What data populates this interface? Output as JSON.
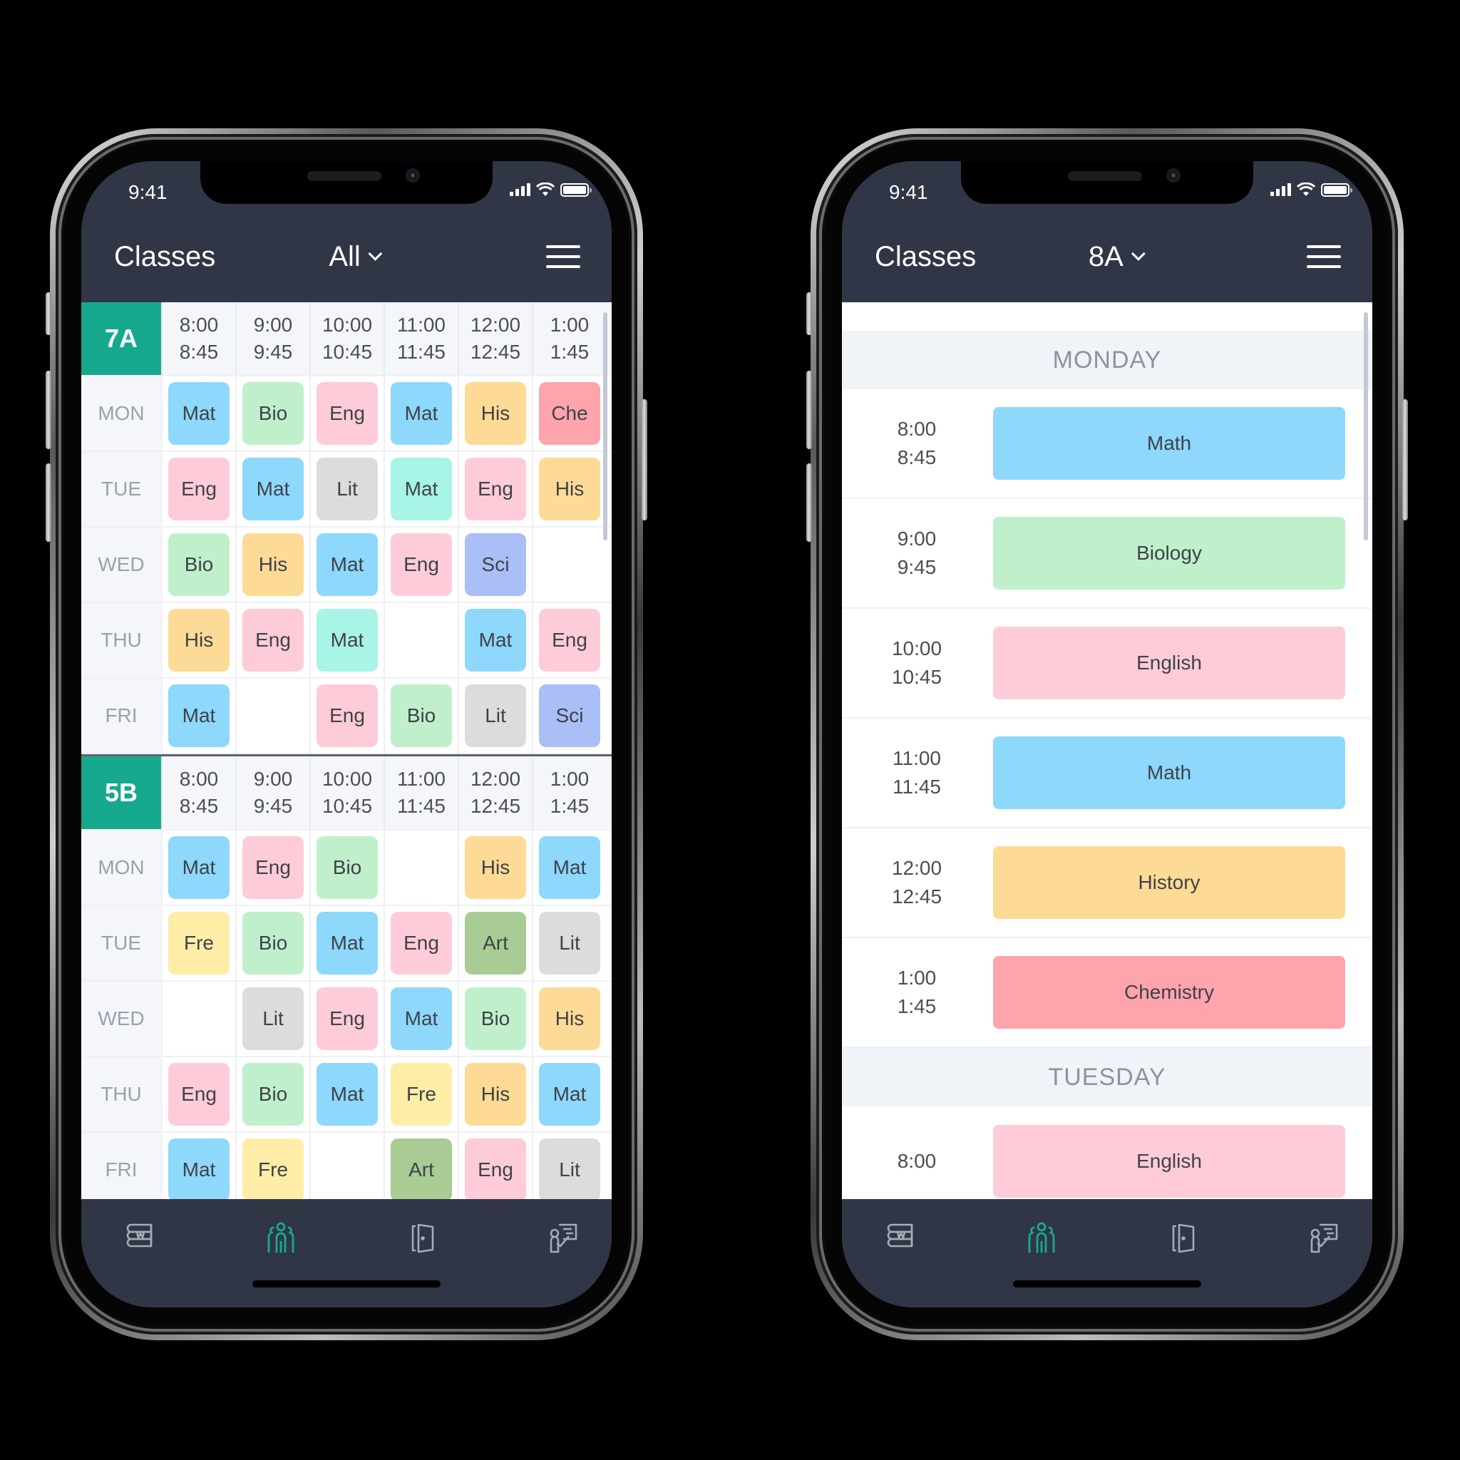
{
  "colors": {
    "accent": "#17a98e",
    "nav_bg": "#303646",
    "icon_inactive": "#a6abb8",
    "subjects": {
      "Mat": "#8dd8fb",
      "Math": "#8dd8fb",
      "Bio": "#c0f0cb",
      "Biology": "#c0f0cb",
      "Eng": "#fdccd8",
      "English": "#fdccd8",
      "His": "#fdda95",
      "History": "#fdda95",
      "Che": "#fda4ad",
      "Chemistry": "#fda4ad",
      "Lit": "#dcdcdc",
      "Sci": "#a9bff5",
      "Fre": "#fdeda6",
      "Art": "#a8cc94",
      "Mat_alt": "#a8f4e6"
    }
  },
  "left_phone": {
    "status": {
      "time": "9:41"
    },
    "header": {
      "title": "Classes",
      "filter": "All"
    },
    "classes": [
      {
        "name": "7A",
        "times": [
          [
            "8:00",
            "8:45"
          ],
          [
            "9:00",
            "9:45"
          ],
          [
            "10:00",
            "10:45"
          ],
          [
            "11:00",
            "11:45"
          ],
          [
            "12:00",
            "12:45"
          ],
          [
            "1:00",
            "1:45"
          ]
        ],
        "days": [
          {
            "day": "MON",
            "lessons": [
              "Mat",
              "Bio",
              "Eng",
              "Mat",
              "His",
              "Che"
            ]
          },
          {
            "day": "TUE",
            "lessons": [
              "Eng",
              "Mat",
              "Lit",
              "Mat*",
              "Eng",
              "His"
            ]
          },
          {
            "day": "WED",
            "lessons": [
              "Bio",
              "His",
              "Mat",
              "Eng",
              "Sci",
              ""
            ]
          },
          {
            "day": "THU",
            "lessons": [
              "His",
              "Eng",
              "Mat*",
              "",
              "Mat",
              "Eng"
            ]
          },
          {
            "day": "FRI",
            "lessons": [
              "Mat",
              "",
              "Eng",
              "Bio",
              "Lit",
              "Sci"
            ]
          }
        ]
      },
      {
        "name": "5B",
        "times": [
          [
            "8:00",
            "8:45"
          ],
          [
            "9:00",
            "9:45"
          ],
          [
            "10:00",
            "10:45"
          ],
          [
            "11:00",
            "11:45"
          ],
          [
            "12:00",
            "12:45"
          ],
          [
            "1:00",
            "1:45"
          ]
        ],
        "days": [
          {
            "day": "MON",
            "lessons": [
              "Mat",
              "Eng",
              "Bio",
              "",
              "His",
              "Mat"
            ]
          },
          {
            "day": "TUE",
            "lessons": [
              "Fre",
              "Bio",
              "Mat",
              "Eng",
              "Art",
              "Lit"
            ]
          },
          {
            "day": "WED",
            "lessons": [
              "",
              "Lit",
              "Eng",
              "Mat",
              "Bio",
              "His"
            ]
          },
          {
            "day": "THU",
            "lessons": [
              "Eng",
              "Bio",
              "Mat",
              "Fre",
              "His",
              "Mat"
            ]
          },
          {
            "day": "FRI",
            "lessons": [
              "Mat",
              "Fre",
              "",
              "Art",
              "Eng",
              "Lit"
            ]
          }
        ]
      }
    ]
  },
  "right_phone": {
    "status": {
      "time": "9:41"
    },
    "header": {
      "title": "Classes",
      "filter": "8A"
    },
    "days": [
      {
        "day": "MONDAY",
        "lessons": [
          {
            "start": "8:00",
            "end": "8:45",
            "subject": "Math"
          },
          {
            "start": "9:00",
            "end": "9:45",
            "subject": "Biology"
          },
          {
            "start": "10:00",
            "end": "10:45",
            "subject": "English"
          },
          {
            "start": "11:00",
            "end": "11:45",
            "subject": "Math"
          },
          {
            "start": "12:00",
            "end": "12:45",
            "subject": "History"
          },
          {
            "start": "1:00",
            "end": "1:45",
            "subject": "Chemistry"
          }
        ]
      },
      {
        "day": "TUESDAY",
        "lessons": [
          {
            "start": "8:00",
            "end": "",
            "subject": "English"
          }
        ]
      }
    ]
  },
  "tabbar": {
    "items": [
      {
        "icon": "books-icon",
        "active": false
      },
      {
        "icon": "people-group-icon",
        "active": true
      },
      {
        "icon": "door-icon",
        "active": false
      },
      {
        "icon": "teacher-board-icon",
        "active": false
      }
    ]
  }
}
